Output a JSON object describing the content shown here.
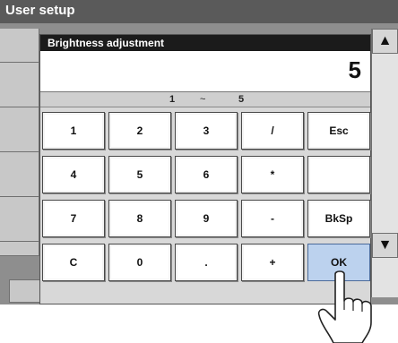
{
  "window": {
    "title": "User setup"
  },
  "dialog": {
    "title": "Brightness adjustment",
    "value": "5",
    "range": {
      "min": "1",
      "separator": "~",
      "max": "5"
    }
  },
  "keypad": {
    "rows": [
      [
        "1",
        "2",
        "3",
        "/",
        "Esc"
      ],
      [
        "4",
        "5",
        "6",
        "*",
        ""
      ],
      [
        "7",
        "8",
        "9",
        "-",
        "BkSp"
      ],
      [
        "C",
        "0",
        ".",
        "+",
        "OK"
      ]
    ]
  },
  "scrollbar": {
    "up_icon": "arrow-up-icon",
    "down_icon": "arrow-down-icon"
  },
  "footer": {
    "esc_label": "Esc"
  },
  "colors": {
    "titlebar": "#5a5a5a",
    "screen": "#8e8e8e",
    "ok_key": "#bcd2ee"
  }
}
